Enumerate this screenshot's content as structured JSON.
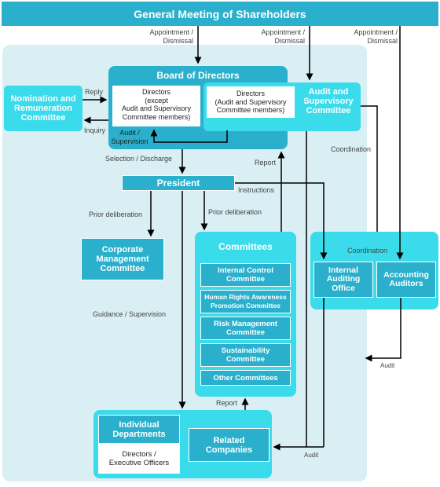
{
  "header": {
    "title": "General Meeting of Shareholders"
  },
  "labels": {
    "appointment1": "Appointment /",
    "dismissal1": "Dismissal",
    "appointment2": "Appointment /",
    "dismissal2": "Dismissal",
    "appointment3": "Appointment /",
    "dismissal3": "Dismissal",
    "reply": "Reply",
    "inquiry": "Inquiry",
    "audit_supervision_1": "Audit /",
    "audit_supervision_2": "Supervision",
    "selection_discharge": "Selection / Discharge",
    "report_board": "Report",
    "coordination_top": "Coordination",
    "instructions": "Instructions",
    "prior_deliberation_left": "Prior deliberation",
    "prior_deliberation_right": "Prior deliberation",
    "coordination_auditors": "Coordination",
    "guidance_supervision": "Guidance / Supervision",
    "audit_right": "Audit",
    "report_committees": "Report",
    "audit_bottom": "Audit"
  },
  "nodes": {
    "nomination": "Nomination and Remuneration Committee",
    "board": "Board of Directors",
    "directors_except": [
      "Directors",
      "(except",
      "Audit and Supervisory",
      "Committee members)"
    ],
    "directors_audit": [
      "Directors",
      "(Audit and Supervisory",
      "Committee members)"
    ],
    "audit_committee": [
      "Audit and",
      "Supervisory",
      "Committee"
    ],
    "president": "President",
    "corporate_mgmt": [
      "Corporate",
      "Management",
      "Committee"
    ],
    "committees": {
      "title": "Committees",
      "items": [
        [
          "Internal Control",
          "Committee"
        ],
        [
          "Human Rights Awareness",
          "Promotion Committee"
        ],
        [
          "Risk Management",
          "Committee"
        ],
        [
          "Sustainability",
          "Committee"
        ],
        [
          "Other Committees"
        ]
      ]
    },
    "internal_auditing": [
      "Internal",
      "Auditing",
      "Office"
    ],
    "accounting_auditors": [
      "Accounting",
      "Auditors"
    ],
    "individual_depts": [
      "Individual",
      "Departments"
    ],
    "directors_officers": [
      "Directors /",
      "Executive Officers"
    ],
    "related_companies": [
      "Related",
      "Companies"
    ]
  },
  "colors": {
    "dark": "#2ab0cc",
    "light": "#3adcec",
    "panel": "#d9eff4"
  }
}
